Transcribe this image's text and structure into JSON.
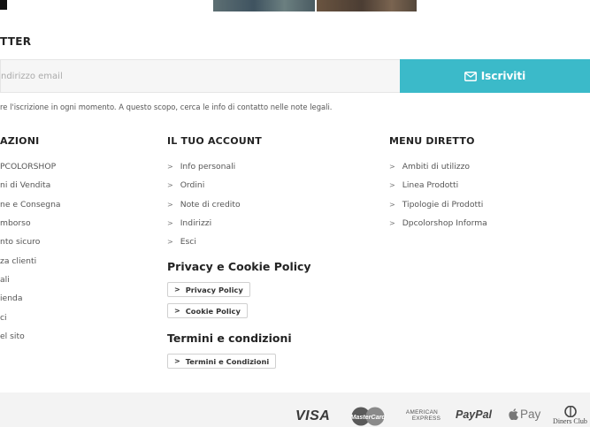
{
  "newsletter": {
    "title": "TTER",
    "email_placeholder": "ndirizzo email",
    "subscribe_label": "Iscriviti",
    "note": "re l'iscrizione in ogni momento. A questo scopo, cerca le info di contatto nelle note legali."
  },
  "columns": {
    "info": {
      "title": "AZIONI",
      "items": [
        "PCOLORSHOP",
        "ni di Vendita",
        "ne e Consegna",
        "mborso",
        "nto sicuro",
        "za clienti",
        "ali",
        "ienda",
        "ci",
        "el sito"
      ]
    },
    "account": {
      "title": "IL TUO ACCOUNT",
      "items": [
        "Info personali",
        "Ordini",
        "Note di credito",
        "Indirizzi",
        "Esci"
      ]
    },
    "menu": {
      "title": "MENU DIRETTO",
      "items": [
        "Ambiti di utilizzo",
        "Linea Prodotti",
        "Tipologie di Prodotti",
        "Dpcolorshop Informa"
      ]
    }
  },
  "privacy": {
    "title": "Privacy e Cookie Policy",
    "privacy_link": "Privacy Policy",
    "cookie_link": "Cookie Policy"
  },
  "terms": {
    "title": "Termini e condizioni",
    "terms_link": "Termini e Condizioni"
  },
  "payments": {
    "visa": "VISA",
    "mastercard": "MasterCard",
    "amex_line1": "AMERICAN",
    "amex_line2": "EXPRESS",
    "paypal": "PayPal",
    "applepay": "Pay",
    "diners": "Diners Club"
  },
  "icons": {
    "subscribe": "envelope-icon",
    "link_arrow": "chevron-right-icon",
    "apple": "apple-icon"
  },
  "colors": {
    "accent": "#3bbac9",
    "footer_bg": "#f3f3f3"
  }
}
